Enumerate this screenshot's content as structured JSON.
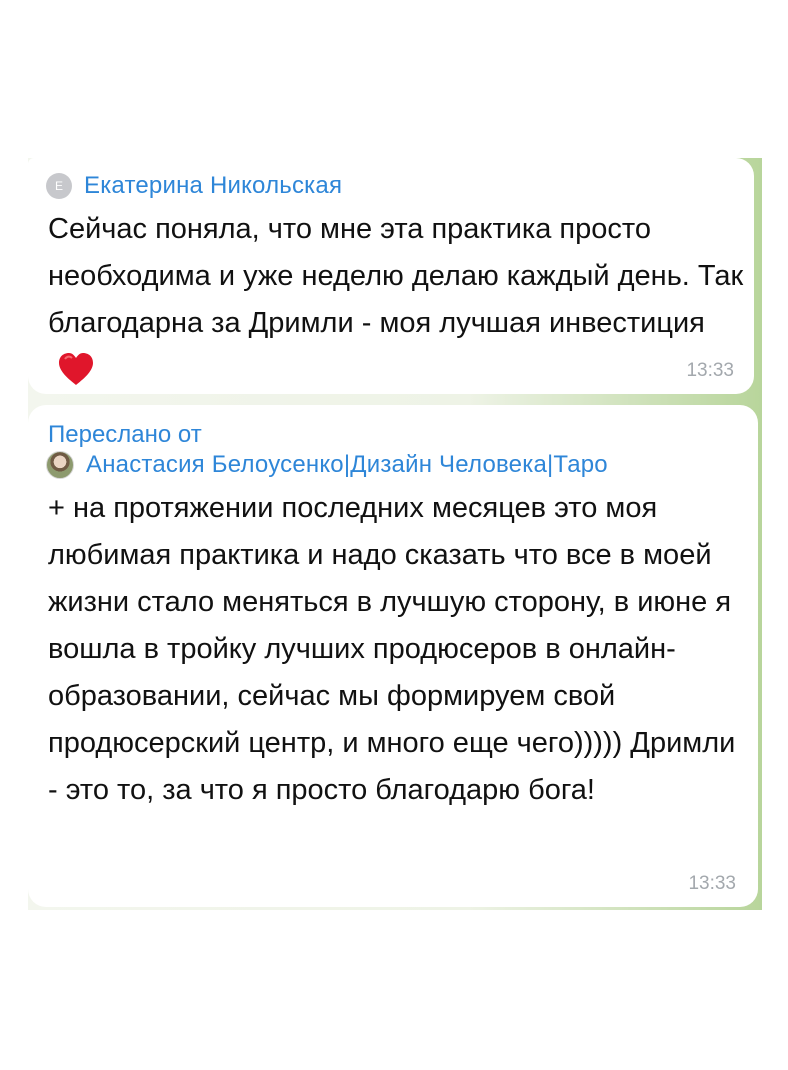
{
  "messages": [
    {
      "sender": "Екатерина Никольская",
      "avatar_initial": "E",
      "text": "Сейчас поняла, что мне эта практика просто необходима и уже неделю делаю каждый день. Так благодарна за Дримли - моя лучшая инвестиция",
      "icon": "red-heart-icon",
      "time": "13:33"
    },
    {
      "forwarded_label": "Переслано от",
      "sender": "Анастасия Белоусенко|Дизайн Человека|Таро",
      "text": "+ на протяжении последних месяцев это моя любимая практика и надо сказать что все в моей жизни стало меняться в лучшую сторону, в июне я вошла в тройку лучших продюсеров в онлайн-образовании, сейчас мы формируем свой продюсерский центр, и много еще чего))))) Дримли - это то, за что я просто благодарю бога!",
      "time": "13:33"
    }
  ],
  "colors": {
    "link_blue": "#2e86d8",
    "heart_red": "#e0162b",
    "timestamp_gray": "#a3a8ad",
    "chat_green": "#b8d59b"
  }
}
